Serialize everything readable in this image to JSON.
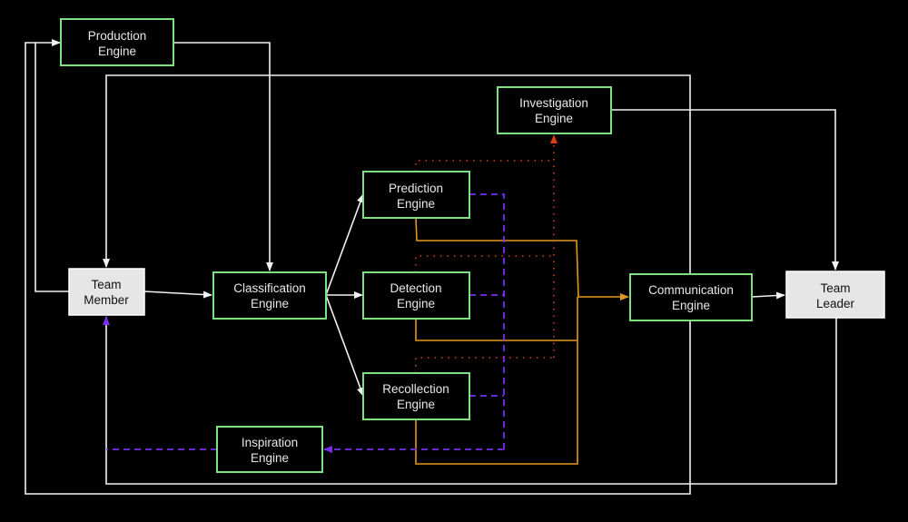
{
  "nodes": {
    "production": {
      "line1": "Production",
      "line2": "Engine"
    },
    "investigation": {
      "line1": "Investigation",
      "line2": "Engine"
    },
    "prediction": {
      "line1": "Prediction",
      "line2": "Engine"
    },
    "classification": {
      "line1": "Classification",
      "line2": "Engine"
    },
    "detection": {
      "line1": "Detection",
      "line2": "Engine"
    },
    "communication": {
      "line1": "Communication",
      "line2": "Engine"
    },
    "recollection": {
      "line1": "Recollection",
      "line2": "Engine"
    },
    "inspiration": {
      "line1": "Inspiration",
      "line2": "Engine"
    },
    "team_member": {
      "line1": "Team",
      "line2": "Member"
    },
    "team_leader": {
      "line1": "Team",
      "line2": "Leader"
    }
  },
  "colors": {
    "background": "#000000",
    "engine_border": "#7ee07f",
    "actor_fill": "#e6e6e6",
    "flow_white": "#f2f2f2",
    "flow_orange": "#e3981f",
    "flow_purple_dashed": "#7a2ef2",
    "flow_red_dotted": "#d9401a"
  }
}
